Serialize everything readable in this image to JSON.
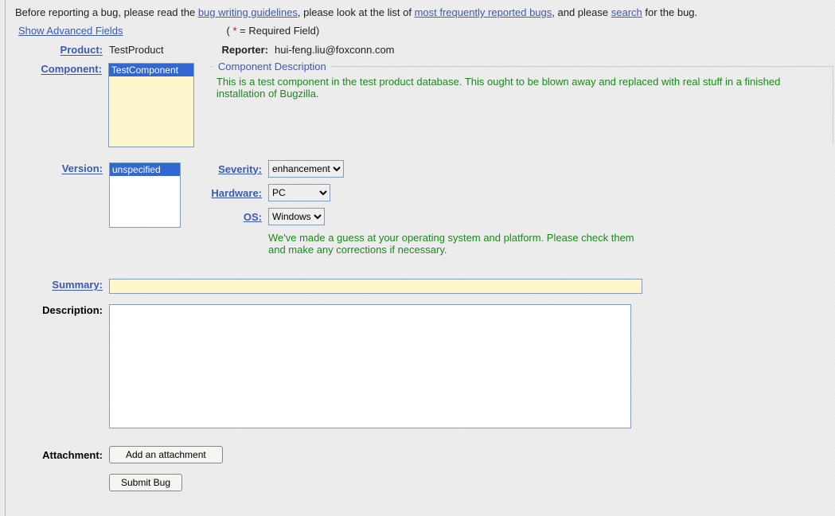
{
  "intro": {
    "pre": "Before reporting a bug, please read the ",
    "link1": "bug writing guidelines",
    "mid1": ", please look at the list of ",
    "link2": "most frequently reported bugs",
    "mid2": ", and please ",
    "link3": "search",
    "post": " for the bug."
  },
  "show_advanced": "Show Advanced Fields",
  "required_note": {
    "open": "( ",
    "star": "*",
    "rest": " = Required Field)"
  },
  "labels": {
    "product": "Product:",
    "reporter": "Reporter:",
    "component": "Component:",
    "version": "Version:",
    "severity": "Severity:",
    "hardware": "Hardware:",
    "os": "OS:",
    "summary": "Summary:",
    "description": "Description:",
    "attachment": "Attachment:"
  },
  "product": "TestProduct",
  "reporter": "hui-feng.liu@foxconn.com",
  "component_selected": "TestComponent",
  "component_desc_title": "Component Description",
  "component_desc_body": "This is a test component in the test product database. This ought to be blown away and replaced with real stuff in a finished installation of Bugzilla.",
  "version_selected": "unspecified",
  "severity_value": "enhancement",
  "hardware_value": "PC",
  "os_value": "Windows",
  "os_note": "We've made a guess at your operating system and platform. Please check them and make any corrections if necessary.",
  "summary_value": "",
  "description_value": "",
  "add_attachment_btn": "Add an attachment",
  "submit_btn": "Submit Bug"
}
